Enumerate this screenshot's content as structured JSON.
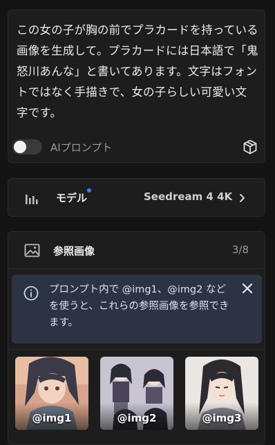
{
  "prompt": {
    "text": "この女の子が胸の前でプラカードを持っている画像を生成して。プラカードには日本語で「鬼怒川あんな」と書いてあります。文字はフォントではなく手描きで、女の子らしい可愛い文字です。",
    "ai_toggle_label": "AIプロンプト",
    "ai_toggle_on": false
  },
  "model": {
    "label": "モデル",
    "value": "Seedream 4 4K"
  },
  "references": {
    "title": "参照画像",
    "count": "3/8",
    "info": "プロンプト内で @img1、@img2 などを使うと、これらの参照画像を参照できます。",
    "images": [
      {
        "label": "@img1"
      },
      {
        "label": "@img2"
      },
      {
        "label": "@img3"
      }
    ]
  },
  "colors": {
    "background": "#141414",
    "card": "#1d1d1d",
    "info_bg": "#2c3342",
    "accent_dot": "#3b82f6"
  },
  "icons": [
    "cube-icon",
    "bar-chart-icon",
    "chevron-right-icon",
    "image-icon",
    "info-icon",
    "close-icon"
  ]
}
